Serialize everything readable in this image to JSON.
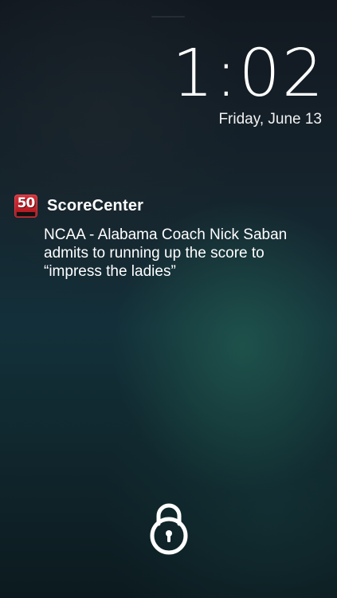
{
  "lockscreen": {
    "time": "1:02",
    "date": "Friday, June 13"
  },
  "notification": {
    "app_icon": {
      "name": "app-logo-icon",
      "badge_text": "50",
      "color": "#c1222b"
    },
    "app_name": "ScoreCenter",
    "message": "NCAA - Alabama Coach Nick Saban admits to running up the score to “impress the ladies”"
  },
  "unlock": {
    "icon": "padlock-icon"
  }
}
